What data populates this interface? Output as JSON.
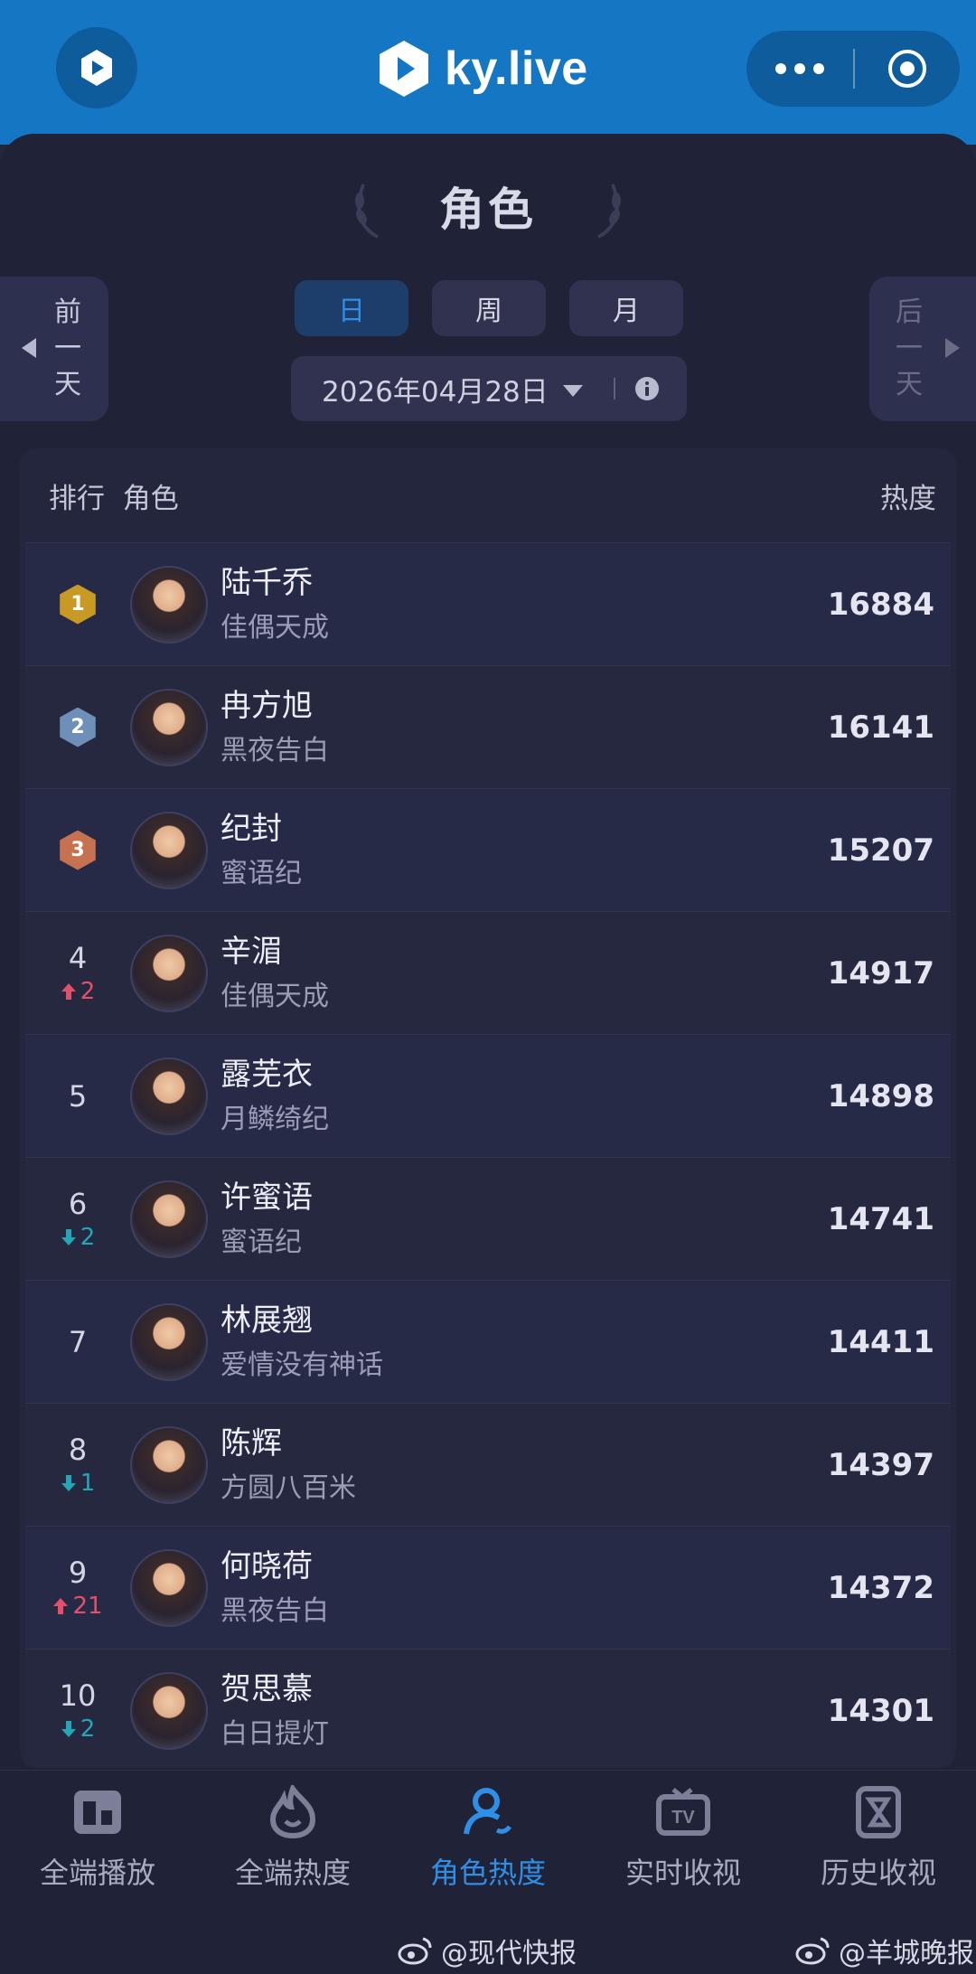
{
  "header": {
    "brand": "ky.live"
  },
  "page": {
    "title": "角色",
    "prev_day": "前一天",
    "next_day": "后一天"
  },
  "period_tabs": [
    {
      "label": "日",
      "active": true
    },
    {
      "label": "周",
      "active": false
    },
    {
      "label": "月",
      "active": false
    }
  ],
  "date_picker": {
    "value": "2026年04月28日"
  },
  "table": {
    "col_rank_role": "排行  角色",
    "col_heat": "热度",
    "rows": [
      {
        "rank": "1",
        "medal": "gold",
        "change": "",
        "direction": "",
        "name": "陆千乔",
        "drama": "佳偶天成",
        "heat": "16884"
      },
      {
        "rank": "2",
        "medal": "silver",
        "change": "",
        "direction": "",
        "name": "冉方旭",
        "drama": "黑夜告白",
        "heat": "16141"
      },
      {
        "rank": "3",
        "medal": "bronze",
        "change": "",
        "direction": "",
        "name": "纪封",
        "drama": "蜜语纪",
        "heat": "15207"
      },
      {
        "rank": "4",
        "medal": "",
        "change": "2",
        "direction": "up",
        "name": "辛湄",
        "drama": "佳偶天成",
        "heat": "14917"
      },
      {
        "rank": "5",
        "medal": "",
        "change": "",
        "direction": "",
        "name": "露芜衣",
        "drama": "月鳞绮纪",
        "heat": "14898"
      },
      {
        "rank": "6",
        "medal": "",
        "change": "2",
        "direction": "down",
        "name": "许蜜语",
        "drama": "蜜语纪",
        "heat": "14741"
      },
      {
        "rank": "7",
        "medal": "",
        "change": "",
        "direction": "",
        "name": "林展翘",
        "drama": "爱情没有神话",
        "heat": "14411"
      },
      {
        "rank": "8",
        "medal": "",
        "change": "1",
        "direction": "down",
        "name": "陈辉",
        "drama": "方圆八百米",
        "heat": "14397"
      },
      {
        "rank": "9",
        "medal": "",
        "change": "21",
        "direction": "up",
        "name": "何晓荷",
        "drama": "黑夜告白",
        "heat": "14372"
      },
      {
        "rank": "10",
        "medal": "",
        "change": "2",
        "direction": "down",
        "name": "贺思慕",
        "drama": "白日提灯",
        "heat": "14301"
      }
    ]
  },
  "tabbar": [
    {
      "label": "全端播放",
      "icon": "play-stats-icon",
      "active": false
    },
    {
      "label": "全端热度",
      "icon": "flame-icon",
      "active": false
    },
    {
      "label": "角色热度",
      "icon": "person-icon",
      "active": true
    },
    {
      "label": "实时收视",
      "icon": "tv-icon",
      "active": false
    },
    {
      "label": "历史收视",
      "icon": "hourglass-icon",
      "active": false
    }
  ],
  "credits": [
    "@现代快报",
    "@羊城晚报"
  ],
  "colors": {
    "header_blue": "#1577c4",
    "accent_blue": "#2f8fe6",
    "up_red": "#e4506a",
    "down_teal": "#23a6b8",
    "background": "#202237"
  }
}
